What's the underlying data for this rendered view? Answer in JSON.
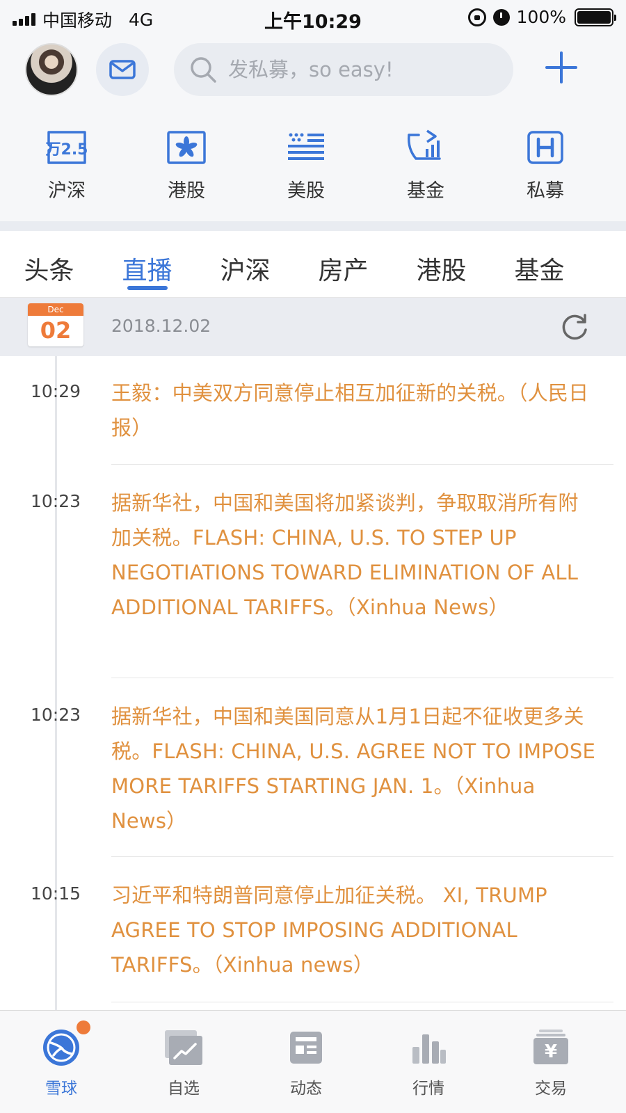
{
  "status_bar": {
    "carrier": "中国移动",
    "network": "4G",
    "time": "上午10:29",
    "battery": "100%"
  },
  "header": {
    "search_placeholder": "发私募，so easy!"
  },
  "markets": [
    {
      "label": "沪深",
      "icon": "a-share-icon"
    },
    {
      "label": "港股",
      "icon": "hk-flag-icon"
    },
    {
      "label": "美股",
      "icon": "us-flag-icon"
    },
    {
      "label": "基金",
      "icon": "fund-icon"
    },
    {
      "label": "私募",
      "icon": "private-fund-icon"
    }
  ],
  "tabs": [
    "头条",
    "直播",
    "沪深",
    "房产",
    "港股",
    "基金"
  ],
  "active_tab": "直播",
  "date_bar": {
    "month": "Dec",
    "day": "02",
    "date": "2018.12.02"
  },
  "news": [
    {
      "time": "10:29",
      "text": "王毅：中美双方同意停止相互加征新的关税。（人民日报）"
    },
    {
      "time": "10:23",
      "text": "据新华社，中国和美国将加紧谈判，争取取消所有附加关税。FLASH: CHINA, U.S. TO STEP UP NEGOTIATIONS TOWARD ELIMINATION OF ALL ADDITIONAL TARIFFS。（Xinhua News）"
    },
    {
      "time": "10:23",
      "text": "据新华社，中国和美国同意从1月1日起不征收更多关税。FLASH: CHINA, U.S. AGREE NOT TO IMPOSE MORE TARIFFS STARTING JAN. 1。（Xinhua News）"
    },
    {
      "time": "10:15",
      "text": "习近平和特朗普同意停止加征关税。 XI, TRUMP AGREE TO STOP IMPOSING ADDITIONAL TARIFFS。（Xinhua news）"
    }
  ],
  "bottom_nav": [
    {
      "label": "雪球",
      "icon": "snowball-icon",
      "active": true
    },
    {
      "label": "自选",
      "icon": "watchlist-icon"
    },
    {
      "label": "动态",
      "icon": "feed-icon"
    },
    {
      "label": "行情",
      "icon": "market-chart-icon"
    },
    {
      "label": "交易",
      "icon": "trade-icon"
    }
  ],
  "colors": {
    "accent": "#3b76d8",
    "news_text": "#e0913f",
    "calendar": "#ee7b3a"
  }
}
